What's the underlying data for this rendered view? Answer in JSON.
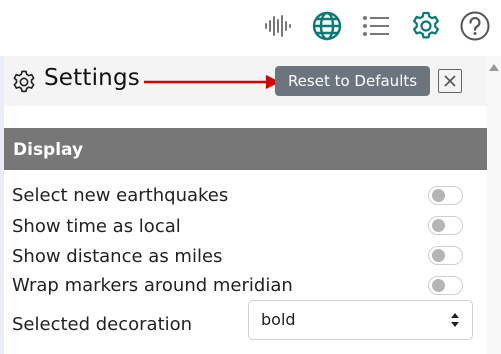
{
  "toolbar": {
    "icons": [
      "waveform-icon",
      "globe-icon",
      "list-icon",
      "gear-icon",
      "help-icon"
    ],
    "accent_color": "#0b7a75"
  },
  "panel": {
    "title": "Settings",
    "reset_label": "Reset to Defaults",
    "close_symbol": "✕",
    "section_title": "Display",
    "rows": [
      {
        "label": "Select new earthquakes",
        "on": false
      },
      {
        "label": "Show time as local",
        "on": false
      },
      {
        "label": "Show distance as miles",
        "on": false
      },
      {
        "label": "Wrap markers around meridian",
        "on": false
      }
    ],
    "decoration": {
      "label": "Selected decoration",
      "value": "bold"
    }
  }
}
